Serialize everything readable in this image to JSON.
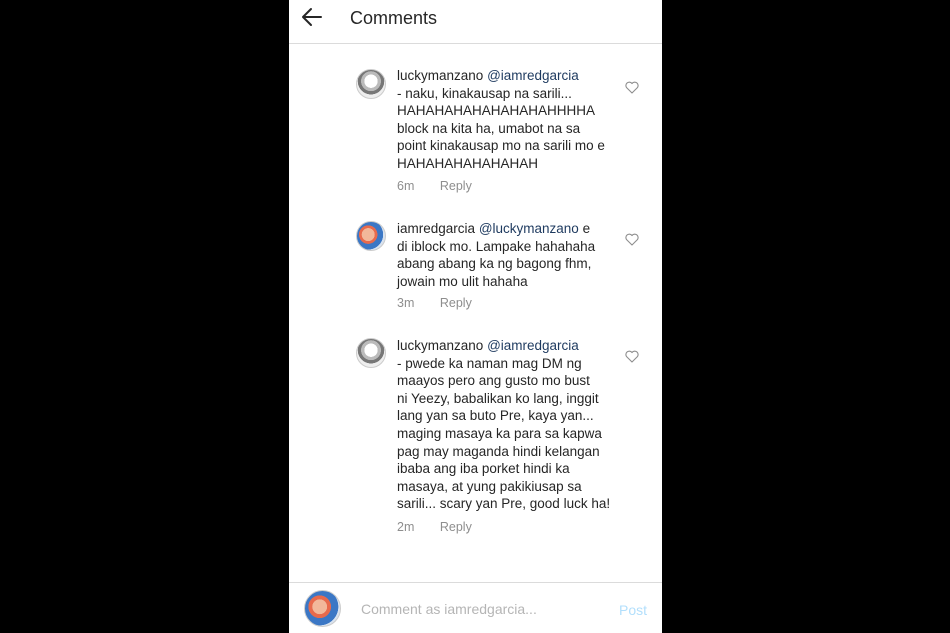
{
  "header": {
    "title": "Comments",
    "back_icon": "arrow-left-icon"
  },
  "comments": [
    {
      "username": "luckymanzano",
      "mention": "@iamredgarcia",
      "lines": [
        "- naku, kinakausap na sarili...",
        "HAHAHAHAHAHAHAHAHHHHA",
        "block na kita ha, umabot na sa",
        "point kinakausap mo na sarili mo e",
        "HAHAHAHAHAHAHAH"
      ],
      "time": "6m",
      "reply": "Reply"
    },
    {
      "username": "iamredgarcia",
      "mention": "@luckymanzano",
      "first_line_tail": "e",
      "lines": [
        "di iblock mo. Lampake hahahaha",
        "abang abang ka ng bagong fhm,",
        "jowain mo ulit hahaha"
      ],
      "time": "3m",
      "reply": "Reply"
    },
    {
      "username": "luckymanzano",
      "mention": "@iamredgarcia",
      "lines": [
        "- pwede ka naman mag DM ng",
        "maayos pero ang gusto mo bust",
        "ni Yeezy, babalikan ko lang, inggit",
        "lang yan sa buto Pre, kaya yan...",
        "maging masaya ka para sa kapwa",
        "pag may maganda hindi kelangan",
        "ibaba ang iba porket hindi ka",
        "masaya, at yung pakikiusap sa",
        "sarili... scary yan Pre, good luck ha!"
      ],
      "time": "2m",
      "reply": "Reply"
    }
  ],
  "footer": {
    "placeholder": "Comment as iamredgarcia...",
    "post_label": "Post",
    "post_color": "#b2dffc"
  }
}
